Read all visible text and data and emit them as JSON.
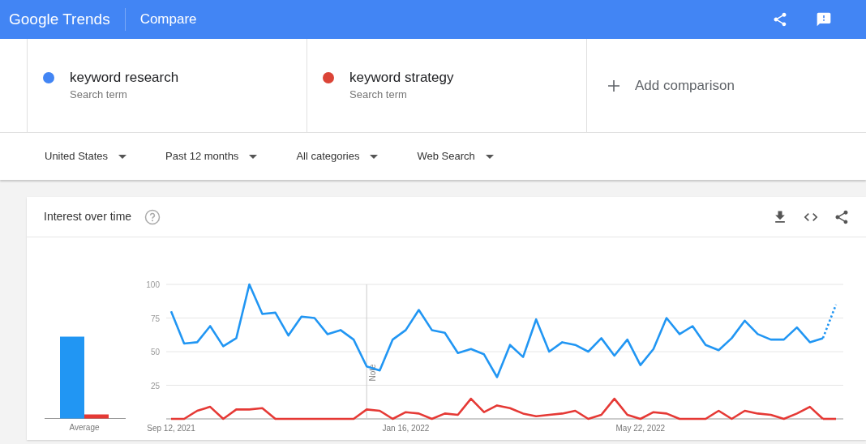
{
  "header": {
    "logo": "Google Trends",
    "title": "Compare"
  },
  "terms": [
    {
      "label": "keyword research",
      "sublabel": "Search term",
      "color": "#4285f4"
    },
    {
      "label": "keyword strategy",
      "sublabel": "Search term",
      "color": "#db4437"
    }
  ],
  "add_comparison": "Add comparison",
  "filters": [
    {
      "label": "United States"
    },
    {
      "label": "Past 12 months"
    },
    {
      "label": "All categories"
    },
    {
      "label": "Web Search"
    }
  ],
  "interest_card": {
    "title": "Interest over time",
    "average_label": "Average",
    "timeline_chart": {
      "chart_data": {
        "type": "line",
        "ylim": [
          0,
          100
        ],
        "yticks": [
          25,
          50,
          75,
          100
        ],
        "categories": [
          "Sep 12, 2021",
          null,
          null,
          null,
          null,
          null,
          null,
          null,
          null,
          null,
          null,
          null,
          null,
          null,
          null,
          null,
          null,
          null,
          "Jan 16, 2022",
          null,
          null,
          null,
          null,
          null,
          null,
          null,
          null,
          null,
          null,
          null,
          null,
          null,
          null,
          null,
          null,
          null,
          "May 22, 2022",
          null,
          null,
          null,
          null,
          null,
          null,
          null,
          null,
          null,
          null,
          null,
          null,
          null,
          null,
          null
        ],
        "series": [
          {
            "color": "#2196f3",
            "values": [
              80,
              56,
              57,
              69,
              54,
              60,
              100,
              78,
              79,
              62,
              76,
              75,
              63,
              66,
              59,
              39,
              36,
              59,
              66,
              81,
              66,
              64,
              49,
              52,
              48,
              31,
              55,
              46,
              74,
              50,
              57,
              55,
              50,
              60,
              47,
              59,
              40,
              52,
              75,
              63,
              69,
              55,
              51,
              60,
              73,
              63,
              59,
              59,
              68,
              57,
              60,
              85
            ]
          },
          {
            "color": "#e53935",
            "values": [
              0,
              0,
              6,
              9,
              0,
              7,
              7,
              8,
              0,
              0,
              0,
              0,
              0,
              0,
              0,
              7,
              6,
              0,
              5,
              4,
              0,
              4,
              3,
              15,
              5,
              10,
              8,
              4,
              2,
              3,
              4,
              6,
              0,
              3,
              15,
              3,
              0,
              5,
              4,
              0,
              0,
              0,
              6,
              0,
              6,
              4,
              3,
              0,
              4,
              9,
              0,
              0
            ]
          }
        ],
        "grid": true,
        "annotations": [
          "Note"
        ]
      }
    }
  }
}
